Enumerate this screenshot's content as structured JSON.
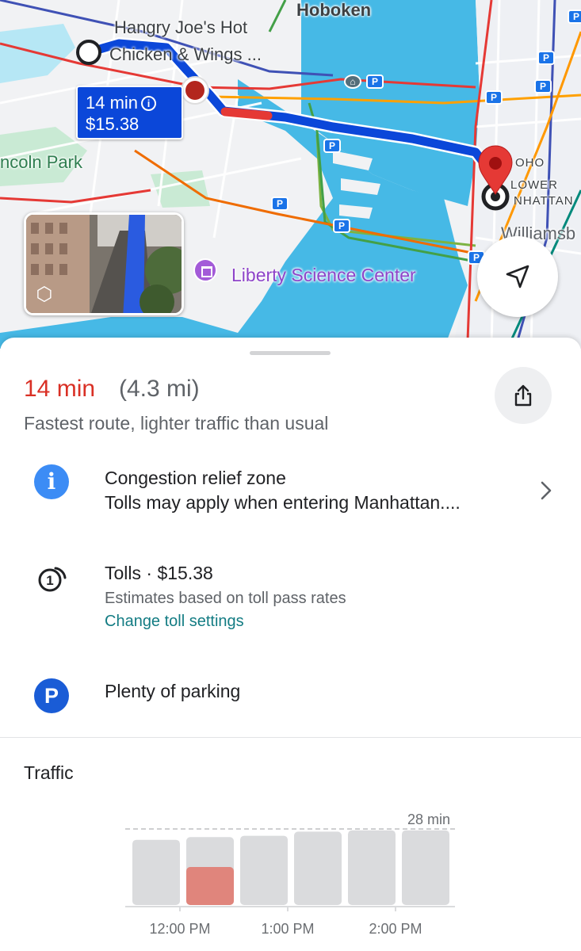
{
  "map": {
    "labels": {
      "hoboken": "Hoboken",
      "restaurant_line1": "Hangry Joe's Hot",
      "restaurant_line2": "Chicken & Wings ...",
      "lincoln_park": "ncoln Park",
      "soho": "OHO",
      "lower": "LOWER",
      "manhattan": "NHATTAN",
      "williamsburg": "Williamsb",
      "liberty_science_center": "Liberty Science Center"
    },
    "route_bubble": {
      "time": "14 min",
      "toll": "$15.38"
    },
    "icons": {
      "info": "info-icon",
      "street_view_3d": "cube-icon",
      "locate": "navigation-arrow-icon",
      "destination": "map-pin-icon",
      "parking": "parking-icon",
      "transit": "train-icon",
      "museum": "museum-icon"
    },
    "colors": {
      "route": "#0b47d9",
      "traffic_slow": "#e53935",
      "water": "#3fb8e8",
      "pin": "#e53935"
    }
  },
  "summary": {
    "eta": "14 min",
    "distance": "(4.3 mi)",
    "description": "Fastest route, lighter traffic than usual",
    "eta_color": "#d93025"
  },
  "details": {
    "congestion": {
      "title": "Congestion relief zone",
      "subtitle": "Tolls may apply when entering Manhattan....",
      "icon": "info-icon"
    },
    "tolls": {
      "title": "Tolls · $15.38",
      "note": "Estimates based on toll pass rates",
      "link": "Change toll settings",
      "icon": "toll-coin-icon"
    },
    "parking": {
      "title": "Plenty of parking",
      "icon": "parking-icon"
    }
  },
  "traffic": {
    "title": "Traffic",
    "max_label": "28 min"
  },
  "chart_data": {
    "type": "bar",
    "title": "Traffic",
    "max_label": "28 min",
    "ylim": [
      0,
      28
    ],
    "x_tick_labels": [
      "12:00 PM",
      "1:00 PM",
      "2:00 PM"
    ],
    "series": [
      {
        "values": [
          24,
          25,
          25.5,
          27,
          27.5,
          27.5
        ],
        "color": "#dadbdd"
      },
      {
        "values": [
          null,
          14,
          null,
          null,
          null,
          null
        ],
        "color": "#e0857c"
      }
    ],
    "current_index": 1
  }
}
